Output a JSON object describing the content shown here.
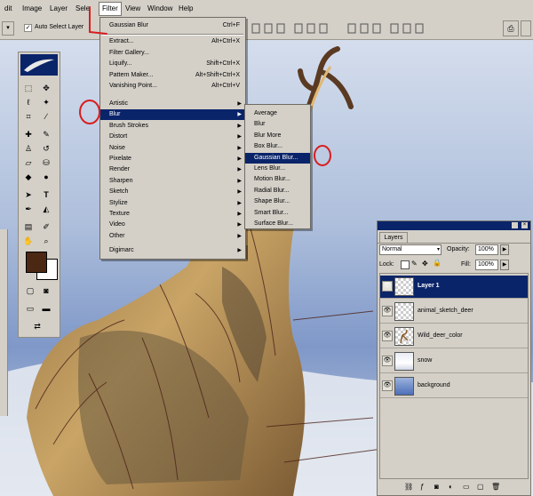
{
  "menubar": {
    "items": [
      "dit",
      "Image",
      "Layer",
      "Sele",
      "Filter",
      "View",
      "Window",
      "Help"
    ]
  },
  "options_bar": {
    "auto_select_label": "Auto Select Layer",
    "auto_select_checked": true
  },
  "filter_menu": {
    "last_filter": {
      "label": "Gaussian Blur",
      "shortcut": "Ctrl+F"
    },
    "group1": [
      {
        "label": "Extract...",
        "shortcut": "Alt+Ctrl+X"
      },
      {
        "label": "Filter Gallery...",
        "shortcut": ""
      },
      {
        "label": "Liquify...",
        "shortcut": "Shift+Ctrl+X"
      },
      {
        "label": "Pattern Maker...",
        "shortcut": "Alt+Shift+Ctrl+X"
      },
      {
        "label": "Vanishing Point...",
        "shortcut": "Alt+Ctrl+V"
      }
    ],
    "categories": [
      "Artistic",
      "Blur",
      "Brush Strokes",
      "Distort",
      "Noise",
      "Pixelate",
      "Render",
      "Sharpen",
      "Sketch",
      "Stylize",
      "Texture",
      "Video",
      "Other"
    ],
    "selected_category": "Blur",
    "extra": [
      "Digimarc"
    ]
  },
  "blur_submenu": {
    "items": [
      "Average",
      "Blur",
      "Blur More",
      "Box Blur...",
      "Gaussian Blur...",
      "Lens Blur...",
      "Motion Blur...",
      "Radial Blur...",
      "Shape Blur...",
      "Smart Blur...",
      "Surface Blur..."
    ],
    "selected": "Gaussian Blur..."
  },
  "layers_panel": {
    "title": "Layers",
    "blend_mode": "Normal",
    "opacity_label": "Opacity:",
    "opacity_value": "100%",
    "lock_label": "Lock:",
    "fill_label": "Fill:",
    "fill_value": "100%",
    "layers": [
      {
        "name": "Layer 1",
        "selected": true
      },
      {
        "name": "animal_sketch_deer",
        "selected": false
      },
      {
        "name": "Wild_deer_color",
        "selected": false
      },
      {
        "name": "snow",
        "selected": false
      },
      {
        "name": "background",
        "selected": false
      }
    ]
  },
  "colors": {
    "foreground": "#4a2814",
    "background": "#ffffff",
    "selection": "#0a246a",
    "annotation": "#d81e1e"
  },
  "icons": [
    "move-icon",
    "marquee-icon",
    "lasso-icon",
    "magic-wand-icon",
    "crop-icon",
    "slice-icon",
    "healing-brush-icon",
    "brush-icon",
    "clone-stamp-icon",
    "history-brush-icon",
    "eraser-icon",
    "paint-bucket-icon",
    "blur-tool-icon",
    "dodge-icon",
    "pen-icon",
    "type-icon",
    "path-select-icon",
    "shape-icon",
    "notes-icon",
    "eyedropper-icon",
    "hand-icon",
    "zoom-icon",
    "eye-icon",
    "lock-icon",
    "link-icon"
  ]
}
